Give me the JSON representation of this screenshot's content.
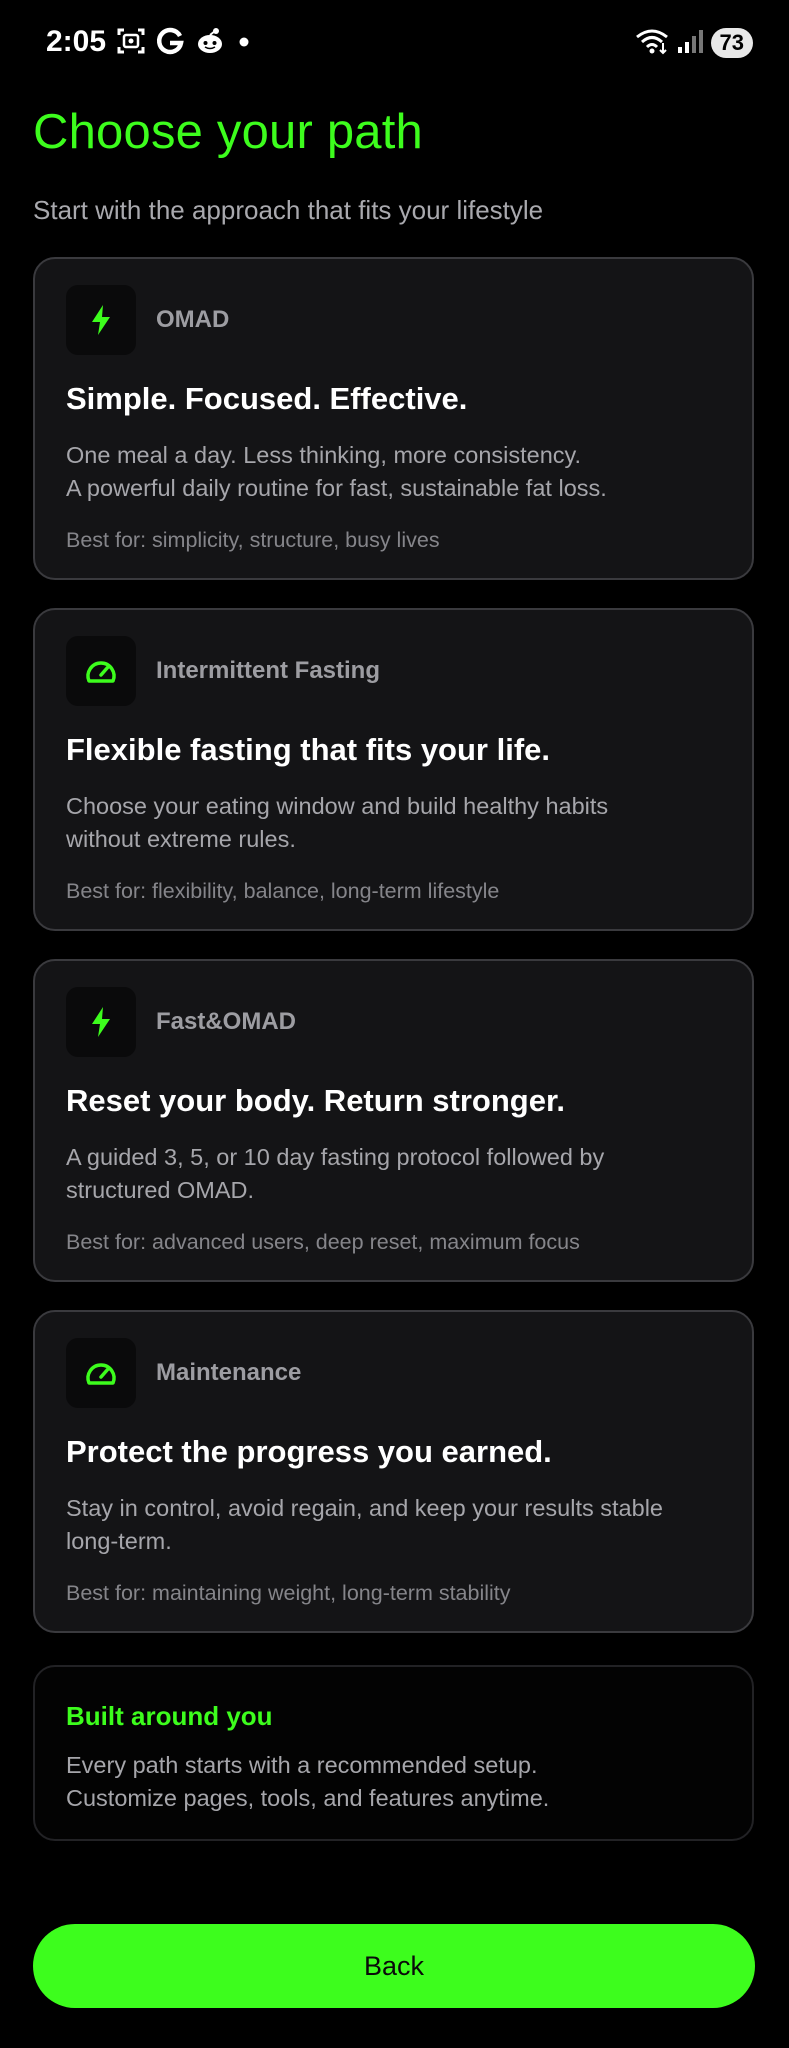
{
  "status_bar": {
    "time": "2:05",
    "battery": "73",
    "left_icons": [
      "screenshot-icon",
      "google-g-icon",
      "reddit-icon",
      "notification-dot-icon"
    ],
    "right_icons": [
      "wifi-icon",
      "signal-icon",
      "battery-icon"
    ]
  },
  "header": {
    "title": "Choose your path",
    "subtitle": "Start with the approach that fits your lifestyle"
  },
  "paths": [
    {
      "icon": "bolt-icon",
      "label": "OMAD",
      "headline": "Simple. Focused. Effective.",
      "description_lines": [
        "One meal a day. Less thinking, more consistency.",
        "A powerful daily routine for fast, sustainable fat loss."
      ],
      "best_for": "Best for: simplicity, structure, busy lives"
    },
    {
      "icon": "gauge-icon",
      "label": "Intermittent Fasting",
      "headline": "Flexible fasting that fits your life.",
      "description_lines": [
        "Choose your eating window and build healthy habits",
        "without extreme rules."
      ],
      "best_for": "Best for: flexibility, balance, long-term lifestyle"
    },
    {
      "icon": "bolt-icon",
      "label": "Fast&OMAD",
      "headline": "Reset your body. Return stronger.",
      "description_lines": [
        "A guided 3, 5, or 10 day fasting protocol followed by",
        "structured OMAD."
      ],
      "best_for": "Best for: advanced users, deep reset, maximum focus"
    },
    {
      "icon": "gauge-icon",
      "label": "Maintenance",
      "headline": "Protect the progress you earned.",
      "description_lines": [
        "Stay in control, avoid regain, and keep your results stable",
        "long-term."
      ],
      "best_for": "Best for: maintaining weight, long-term stability"
    }
  ],
  "info": {
    "title": "Built around you",
    "lines": [
      "Every path starts with a recommended setup.",
      "Customize pages, tools, and features anytime."
    ]
  },
  "back_button": {
    "label": "Back"
  },
  "colors": {
    "accent": "#3dfd1d",
    "background": "#000000",
    "card": "#141416",
    "card_border": "#3a3a3e"
  }
}
